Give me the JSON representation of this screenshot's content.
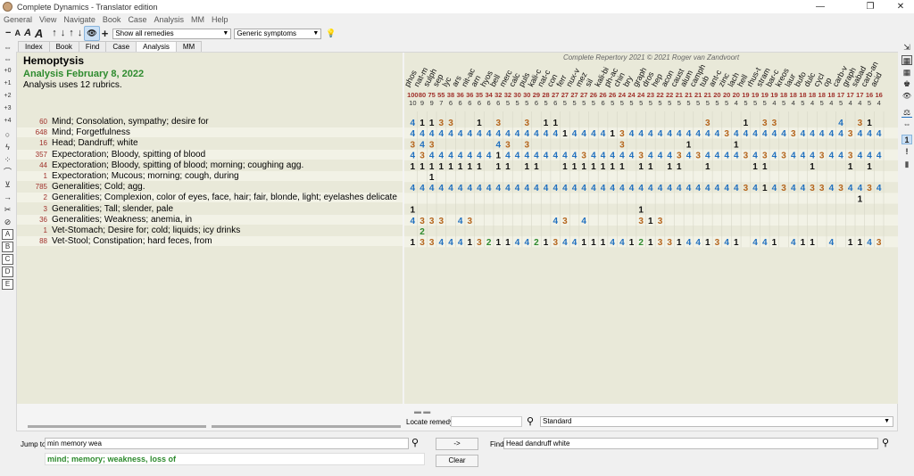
{
  "window": {
    "title": "Complete Dynamics - Translator edition",
    "controls": [
      "—",
      "❐",
      "✕"
    ]
  },
  "menu": [
    "General",
    "View",
    "Navigate",
    "Book",
    "Case",
    "Analysis",
    "MM",
    "Help"
  ],
  "toolbar": {
    "minus": "−",
    "font_a_small": "A",
    "font_a_italic": "A",
    "font_a_big": "A",
    "arrow_up": "↑",
    "arrow_down": "↓",
    "arrow_up2": "↑",
    "arrow_down2": "↓",
    "eye": "👁",
    "plus": "+",
    "remedies_filter": "Show all remedies",
    "symptoms_filter": "Generic symptoms",
    "bulb": "💡"
  },
  "tabs": [
    "Index",
    "Book",
    "Find",
    "Case",
    "Analysis",
    "MM"
  ],
  "active_tab": "Analysis",
  "left_tools": [
    "⇔",
    "⇔",
    "+0",
    "+1",
    "+2",
    "+3",
    "+4",
    "○",
    "ϟ",
    "⁘",
    "⌒",
    "⊻",
    "→",
    "✂",
    "⊘"
  ],
  "left_tabs": [
    "A",
    "B",
    "C",
    "D",
    "E"
  ],
  "right_tools": [
    "⇲",
    "▦",
    "▦",
    "♚",
    "👁",
    "⚖",
    "⇔",
    "1",
    "!",
    "▮"
  ],
  "report": {
    "title": "Hemoptysis",
    "subtitle": "Analysis February 8, 2022",
    "rubric_count_text": "Analysis uses 12 rubrics.",
    "copyright": "Complete Repertory 2021 © 2021 Roger van Zandvoort"
  },
  "rubrics": [
    {
      "count": "60",
      "text": "Mind; Consolation, sympathy; desire for"
    },
    {
      "count": "648",
      "text": "Mind; Forgetfulness"
    },
    {
      "count": "16",
      "text": "Head; Dandruff; white"
    },
    {
      "count": "357",
      "text": "Expectoration; Bloody, spitting of blood"
    },
    {
      "count": "44",
      "text": "Expectoration; Bloody, spitting of blood; morning; coughing agg."
    },
    {
      "count": "1",
      "text": "Expectoration; Mucous; morning; cough, during"
    },
    {
      "count": "785",
      "text": "Generalities; Cold; agg."
    },
    {
      "count": "2",
      "text": "Generalities; Complexion, color of eyes, face, hair; fair, blonde, light; eyelashes delicate"
    },
    {
      "count": "3",
      "text": "Generalities; Tall; slender, pale"
    },
    {
      "count": "36",
      "text": "Generalities; Weakness; anemia, in"
    },
    {
      "count": "1",
      "text": "Vet-Stomach; Desire for; cold; liquids; icy drinks"
    },
    {
      "count": "88",
      "text": "Vet-Stool; Constipation; hard feces, from"
    }
  ],
  "remedies": [
    {
      "name": "phos",
      "score": "100",
      "rubrics": "10"
    },
    {
      "name": "nat-m",
      "score": "80",
      "rubrics": "9"
    },
    {
      "name": "sulph",
      "score": "75",
      "rubrics": "9"
    },
    {
      "name": "sep",
      "score": "55",
      "rubrics": "7"
    },
    {
      "name": "lyc",
      "score": "38",
      "rubrics": "6"
    },
    {
      "name": "ars",
      "score": "36",
      "rubrics": "6"
    },
    {
      "name": "nit-ac",
      "score": "36",
      "rubrics": "6"
    },
    {
      "name": "arn",
      "score": "35",
      "rubrics": "6"
    },
    {
      "name": "hyos",
      "score": "34",
      "rubrics": "6"
    },
    {
      "name": "bell",
      "score": "32",
      "rubrics": "6"
    },
    {
      "name": "merc",
      "score": "32",
      "rubrics": "5"
    },
    {
      "name": "calc",
      "score": "30",
      "rubrics": "5"
    },
    {
      "name": "puls",
      "score": "30",
      "rubrics": "5"
    },
    {
      "name": "kali-c",
      "score": "29",
      "rubrics": "6"
    },
    {
      "name": "nat-c",
      "score": "28",
      "rubrics": "5"
    },
    {
      "name": "con",
      "score": "27",
      "rubrics": "6"
    },
    {
      "name": "ferr",
      "score": "27",
      "rubrics": "5"
    },
    {
      "name": "nux-v",
      "score": "27",
      "rubrics": "5"
    },
    {
      "name": "mez",
      "score": "27",
      "rubrics": "5"
    },
    {
      "name": "sil",
      "score": "26",
      "rubrics": "5"
    },
    {
      "name": "kali-bi",
      "score": "26",
      "rubrics": "6"
    },
    {
      "name": "ph-ac",
      "score": "26",
      "rubrics": "5"
    },
    {
      "name": "chin",
      "score": "24",
      "rubrics": "5"
    },
    {
      "name": "bry",
      "score": "24",
      "rubrics": "5"
    },
    {
      "name": "graph",
      "score": "24",
      "rubrics": "5"
    },
    {
      "name": "dros",
      "score": "23",
      "rubrics": "5"
    },
    {
      "name": "hep",
      "score": "22",
      "rubrics": "5"
    },
    {
      "name": "acon",
      "score": "22",
      "rubrics": "5"
    },
    {
      "name": "caust",
      "score": "21",
      "rubrics": "5"
    },
    {
      "name": "alum",
      "score": "21",
      "rubrics": "5"
    },
    {
      "name": "camph",
      "score": "21",
      "rubrics": "5"
    },
    {
      "name": "tub",
      "score": "21",
      "rubrics": "5"
    },
    {
      "name": "ant-c",
      "score": "20",
      "rubrics": "5"
    },
    {
      "name": "zinc",
      "score": "20",
      "rubrics": "5"
    },
    {
      "name": "lach",
      "score": "20",
      "rubrics": "4"
    },
    {
      "name": "hell",
      "score": "19",
      "rubrics": "5"
    },
    {
      "name": "rhus-t",
      "score": "19",
      "rubrics": "5"
    },
    {
      "name": "stram",
      "score": "19",
      "rubrics": "5"
    },
    {
      "name": "bar-c",
      "score": "19",
      "rubrics": "4"
    },
    {
      "name": "kreos",
      "score": "18",
      "rubrics": "5"
    },
    {
      "name": "laur",
      "score": "18",
      "rubrics": "4"
    },
    {
      "name": "bufo",
      "score": "18",
      "rubrics": "5"
    },
    {
      "name": "dulc",
      "score": "18",
      "rubrics": "4"
    },
    {
      "name": "cycl",
      "score": "18",
      "rubrics": "5"
    },
    {
      "name": "op",
      "score": "18",
      "rubrics": "4"
    },
    {
      "name": "carb-v",
      "score": "17",
      "rubrics": "5"
    },
    {
      "name": "graph",
      "score": "17",
      "rubrics": "4"
    },
    {
      "name": "sabad",
      "score": "17",
      "rubrics": "4"
    },
    {
      "name": "carb-an",
      "score": "16",
      "rubrics": "5"
    },
    {
      "name": "acid",
      "score": "16",
      "rubrics": "4"
    }
  ],
  "grid": [
    "41133..1.3..3.11...............3...1.33......4.31.....1",
    "44444444444444441444413444444444434444443444443444344334",
    "343......43.3.........3......1....1...................",
    "43444444414444444434444434443434444343434443443444334443411",
    "11111111.11.11..1111111.11.11..1....11....1...1.1.......",
    "..1...................................................",
    "44444444444444444444444444444444444341434433434434434343441",
    "...............................................1........",
    "1.......................1...........................",
    "4333.43........43.4.....313.......................13......13",
    ".2...................................................",
    "13344413211442134411144121331441341.441.411.4.1143412"
  ],
  "grid_colors": {
    "1": "#111111",
    "2": "#2e8b2e",
    "3": "#b5651d",
    "4": "#1f6fbf"
  },
  "locate": {
    "label": "Locate remedy",
    "value": "",
    "mode": "Standard"
  },
  "jump": {
    "label": "Jump to",
    "value": "min memory wea",
    "suggestion": "mind; memory; weakness, loss of"
  },
  "find": {
    "label": "Find",
    "value": "Head dandruff white"
  },
  "buttons": {
    "go": "->",
    "clear": "Clear"
  }
}
